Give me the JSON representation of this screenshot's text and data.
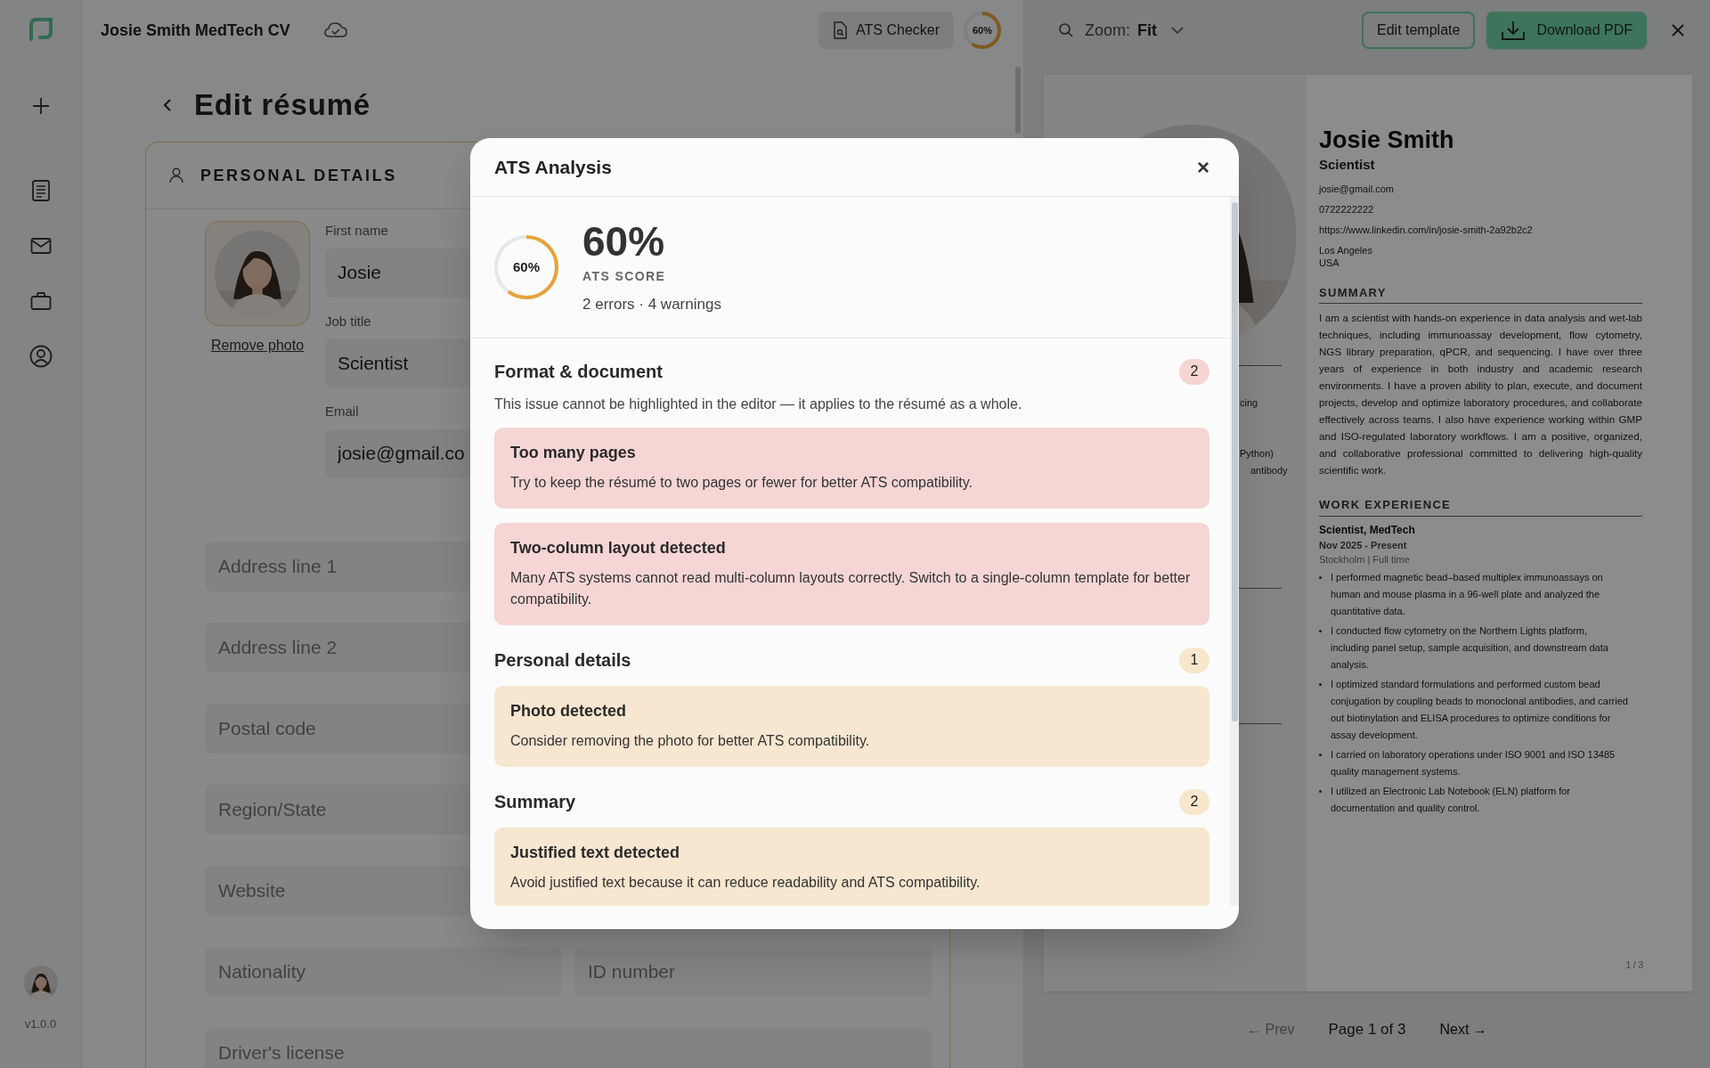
{
  "sidebar": {
    "version": "v1.0.0"
  },
  "header": {
    "document_title": "Josie Smith MedTech CV",
    "ats_button": "ATS Checker",
    "score_badge": {
      "text": "60%",
      "level": 0.6
    }
  },
  "editor": {
    "title": "Edit résumé",
    "section_title": "PERSONAL DETAILS",
    "remove_photo": "Remove photo",
    "fields": [
      {
        "label": "First name",
        "value": "Josie"
      },
      {
        "label": "Job title",
        "value": "Scientist"
      },
      {
        "label": "Email",
        "value": "josie@gmail.co"
      }
    ],
    "rows": [
      {
        "fields": [
          {
            "placeholder": "Address line 1"
          }
        ]
      },
      {
        "fields": [
          {
            "placeholder": "Address line 2"
          }
        ]
      },
      {
        "fields": [
          {
            "placeholder": "Postal code"
          }
        ]
      },
      {
        "fields": [
          {
            "placeholder": "Region/State"
          }
        ]
      },
      {
        "fields": [
          {
            "placeholder": "Website"
          }
        ]
      },
      {
        "fields": [
          {
            "placeholder": "Nationality"
          },
          {
            "placeholder": "ID number"
          }
        ]
      },
      {
        "fields": [
          {
            "placeholder": "Driver's license"
          }
        ]
      }
    ]
  },
  "preview": {
    "zoom_label": "Zoom:",
    "zoom_value": "Fit",
    "edit_template": "Edit template",
    "download": "Download PDF",
    "resume": {
      "name": "Josie Smith",
      "role": "Scientist",
      "contact": [
        {
          "lines": [
            "josie@gmail.com"
          ]
        },
        {
          "lines": [
            "0722222222"
          ]
        },
        {
          "lines": [
            "https://www.linkedin.com/in/josie-smith-2a92b2c2"
          ]
        },
        {
          "lines": [
            "Los Angeles",
            "USA"
          ]
        }
      ],
      "left_fragments": [
        "cing",
        "Python)",
        "antibody"
      ],
      "sections": [
        {
          "heading": "SUMMARY",
          "kind": "paragraph",
          "text": "I am a scientist with hands-on experience in data analysis and wet-lab techniques, including immunoassay development, flow cytometry, NGS library preparation, qPCR, and sequencing. I have over three years of experience in both industry and academic research environments. I have a proven ability to plan, execute, and document projects, develop and optimize laboratory procedures, and collaborate effectively across teams. I also have experience working within GMP and ISO-regulated laboratory workflows. I am a positive, organized, and collaborative professional committed to delivering high-quality scientific work."
        },
        {
          "heading": "WORK EXPERIENCE",
          "kind": "jobs",
          "jobs": [
            {
              "title": "Scientist, MedTech",
              "dates": "Nov 2025 - Present",
              "place": "Stockholm | Full time",
              "bullets": [
                "I performed magnetic bead–based multiplex immunoassays on human and mouse plasma in a 96-well plate and analyzed the quantitative data.",
                "I conducted flow cytometry on the Northern Lights platform, including panel setup, sample acquisition, and downstream data analysis.",
                "I optimized standard formulations and performed custom bead conjugation by coupling beads to monoclonal antibodies, and carried out biotinylation and ELISA procedures to optimize conditions for assay development.",
                "I carried on laboratory operations under ISO 9001 and ISO 13485 quality management systems.",
                "I utilized an Electronic Lab Notebook (ELN) platform for documentation and quality control."
              ]
            }
          ]
        }
      ],
      "page_number": "1 / 3"
    },
    "pager": {
      "prev": "← Prev",
      "page": "Page 1 of 3",
      "next": "Next →"
    }
  },
  "modal": {
    "title": "ATS Analysis",
    "close": "×",
    "score": {
      "ring_text": "60%",
      "value": "60%",
      "label": "ATS SCORE",
      "summary": "2 errors · 4 warnings",
      "level": 0.6
    },
    "sections": [
      {
        "title": "Format & document",
        "count": "2",
        "kind": "error",
        "note": "This issue cannot be highlighted in the editor — it applies to the résumé as a whole.",
        "issues": [
          {
            "title": "Too many pages",
            "text": "Try to keep the résumé to two pages or fewer for better ATS compatibility."
          },
          {
            "title": "Two-column layout detected",
            "text": "Many ATS systems cannot read multi-column layouts correctly. Switch to a single-column template for better compatibility."
          }
        ]
      },
      {
        "title": "Personal details",
        "count": "1",
        "kind": "warning",
        "issues": [
          {
            "title": "Photo detected",
            "text": "Consider removing the photo for better ATS compatibility."
          }
        ]
      },
      {
        "title": "Summary",
        "count": "2",
        "kind": "warning",
        "issues": [
          {
            "title": "Justified text detected",
            "text": "Avoid justified text because it can reduce readability and ATS compatibility."
          }
        ]
      }
    ]
  }
}
